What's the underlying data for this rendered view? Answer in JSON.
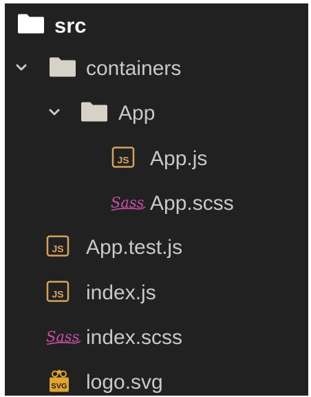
{
  "tree": {
    "root": {
      "label": "src",
      "icon": "folder-icon"
    },
    "items": [
      {
        "label": "containers",
        "icon": "folder-icon",
        "expanded": true
      },
      {
        "label": "App",
        "icon": "folder-icon",
        "expanded": true
      },
      {
        "label": "App.js",
        "icon": "js-file-icon"
      },
      {
        "label": "App.scss",
        "icon": "sass-file-icon"
      },
      {
        "label": "App.test.js",
        "icon": "js-file-icon"
      },
      {
        "label": "index.js",
        "icon": "js-file-icon"
      },
      {
        "label": "index.scss",
        "icon": "sass-file-icon"
      },
      {
        "label": "logo.svg",
        "icon": "svg-file-icon"
      }
    ]
  },
  "colors": {
    "panel_bg": "#212121",
    "text": "#c9c9c9",
    "root_folder": "#ffffff",
    "folder": "#d6d2c8",
    "js_icon": "#d8a35a",
    "sass_icon": "#cc4fa8",
    "svg_icon": "#e2a530",
    "chevron": "#c9c9c9"
  }
}
